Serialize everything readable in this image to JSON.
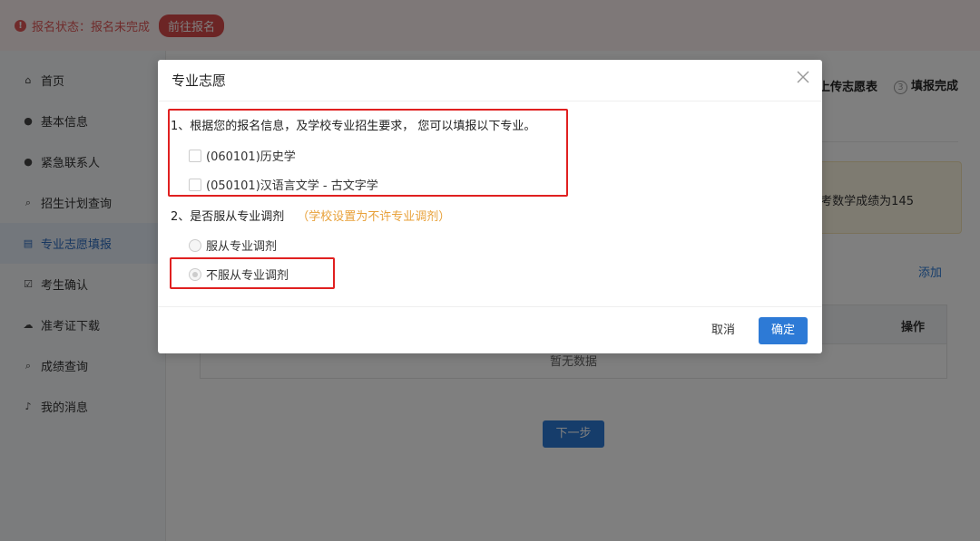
{
  "topbar": {
    "status_text": "报名状态：报名未完成",
    "go_button": "前往报名"
  },
  "sidebar": {
    "items": [
      {
        "icon": "home-icon",
        "glyph": "⌂",
        "label": "首页"
      },
      {
        "icon": "user-icon",
        "glyph": "●",
        "label": "基本信息"
      },
      {
        "icon": "user-icon",
        "glyph": "●",
        "label": "紧急联系人"
      },
      {
        "icon": "search-icon",
        "glyph": "⌕",
        "label": "招生计划查询"
      },
      {
        "icon": "document-icon",
        "glyph": "▤",
        "label": "专业志愿填报"
      },
      {
        "icon": "check-icon",
        "glyph": "☑",
        "label": "考生确认"
      },
      {
        "icon": "cloud-download-icon",
        "glyph": "☁",
        "label": "准考证下载"
      },
      {
        "icon": "search-icon",
        "glyph": "⌕",
        "label": "成绩查询"
      },
      {
        "icon": "bell-icon",
        "glyph": "♪",
        "label": "我的消息"
      }
    ]
  },
  "main": {
    "step_upload": "上传志愿表",
    "step_done": "填报完成",
    "step_done_num": "3",
    "notice_text": "考数学成绩为145",
    "add_link": "添加",
    "table_op_header": "操作",
    "table_empty": "暂无数据",
    "next_button": "下一步"
  },
  "dialog": {
    "title": "专业志愿",
    "q1": "1、根据您的报名信息，及学校专业招生要求， 您可以填报以下专业。",
    "majors": [
      "(060101)历史学",
      "(050101)汉语言文学 - 古文字学"
    ],
    "q2": "2、是否服从专业调剂",
    "q2_note": "（学校设置为不许专业调剂）",
    "radio_obey": "服从专业调剂",
    "radio_not_obey": "不服从专业调剂",
    "cancel": "取消",
    "ok": "确定"
  },
  "colors": {
    "primary": "#2d7ad6",
    "danger": "#e05757",
    "warning": "#e8a13a",
    "highlight_box": "#e02020"
  }
}
